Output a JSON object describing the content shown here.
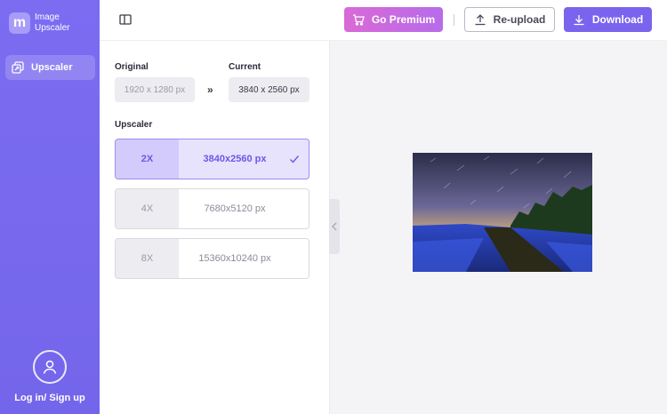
{
  "app": {
    "logo_letter": "m",
    "name_line1": "Image",
    "name_line2": "Upscaler"
  },
  "sidebar": {
    "items": [
      {
        "label": "Upscaler",
        "icon": "upscale-icon"
      }
    ],
    "login_label": "Log in/ Sign up"
  },
  "toolbar": {
    "premium_label": "Go Premium",
    "reupload_label": "Re-upload",
    "download_label": "Download"
  },
  "panel": {
    "original_label": "Original",
    "original_value": "1920 x 1280 px",
    "current_label": "Current",
    "current_value": "3840 x 2560 px",
    "arrows": "»",
    "upscaler_label": "Upscaler",
    "options": [
      {
        "scale": "2X",
        "resolution": "3840x2560 px",
        "selected": true
      },
      {
        "scale": "4X",
        "resolution": "7680x5120 px",
        "selected": false
      },
      {
        "scale": "8X",
        "resolution": "15360x10240 px",
        "selected": false
      }
    ]
  },
  "colors": {
    "sidebar": "#7b6cf2",
    "accent": "#7a64ee",
    "premium_start": "#d96ad6",
    "premium_end": "#b76bea",
    "selected_bg": "#e7e3fd"
  }
}
